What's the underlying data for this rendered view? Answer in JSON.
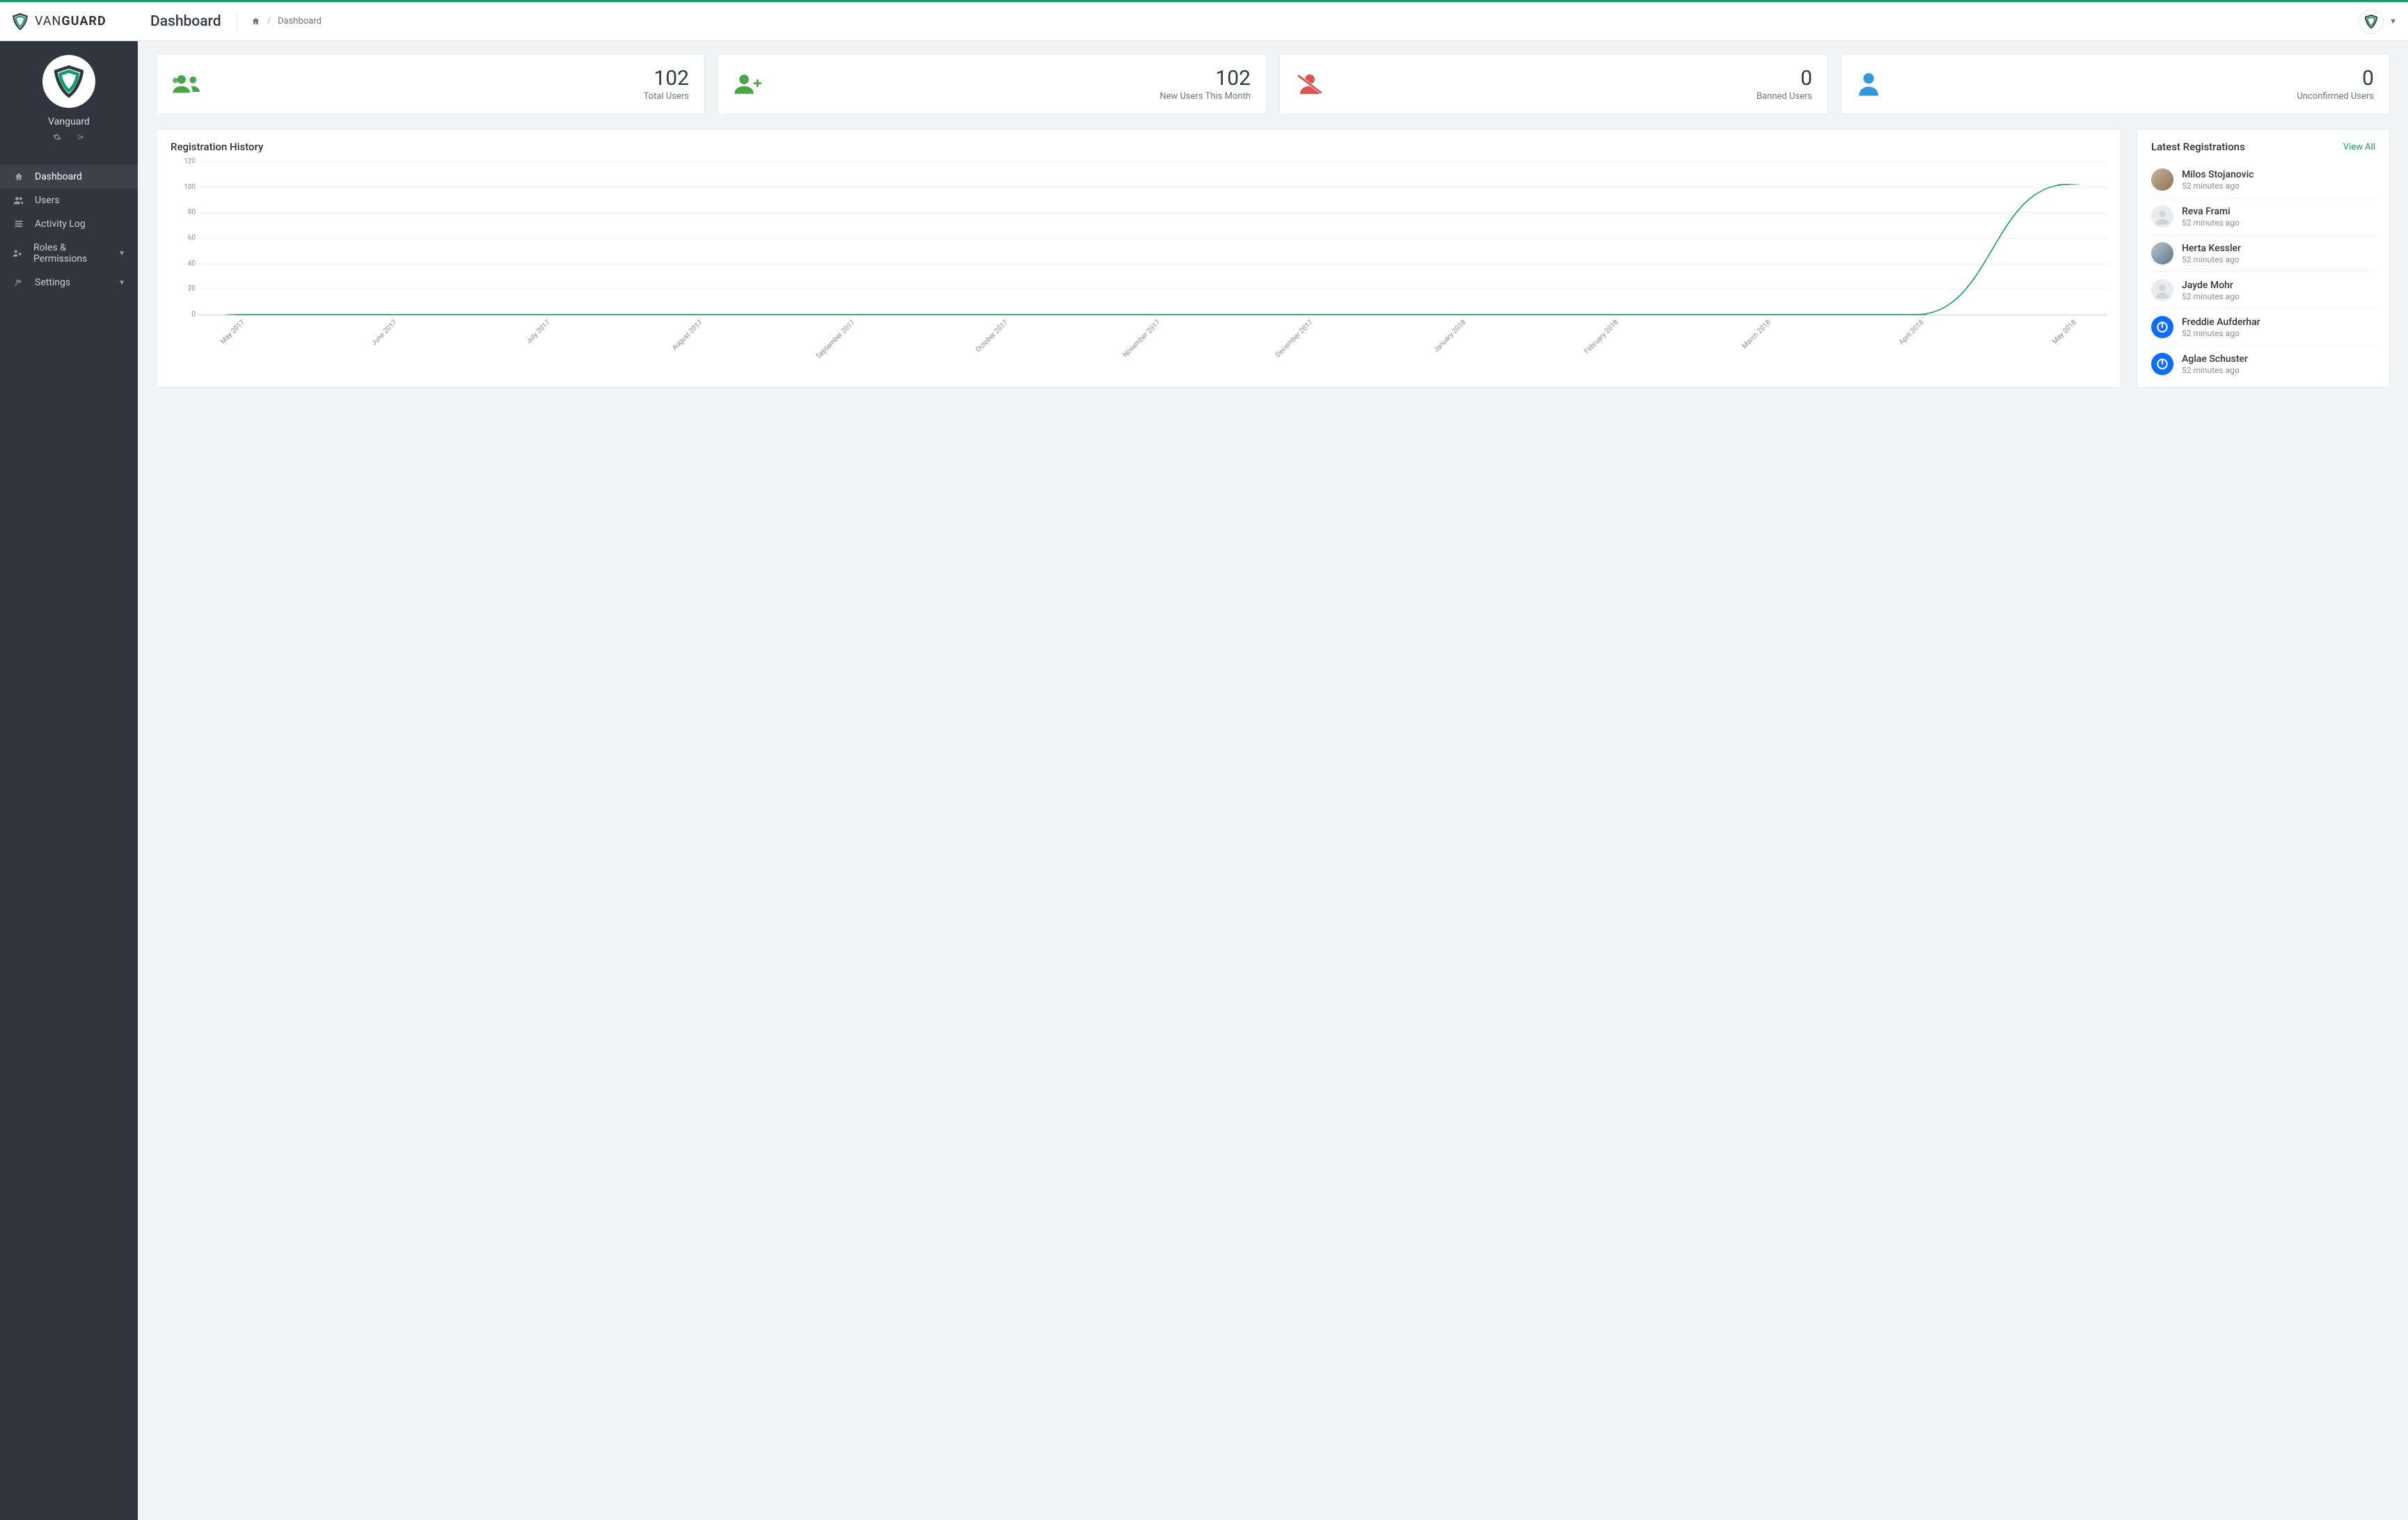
{
  "brand": {
    "name_light": "VAN",
    "name_bold": "GUARD"
  },
  "header": {
    "page_title": "Dashboard",
    "breadcrumb_current": "Dashboard"
  },
  "sidebar": {
    "username": "Vanguard",
    "items": [
      {
        "label": "Dashboard",
        "icon": "home",
        "active": true,
        "expandable": false
      },
      {
        "label": "Users",
        "icon": "users",
        "active": false,
        "expandable": false
      },
      {
        "label": "Activity Log",
        "icon": "list",
        "active": false,
        "expandable": false
      },
      {
        "label": "Roles & Permissions",
        "icon": "users-cog",
        "active": false,
        "expandable": true
      },
      {
        "label": "Settings",
        "icon": "cogs",
        "active": false,
        "expandable": true
      }
    ]
  },
  "stats": [
    {
      "value": "102",
      "label": "Total Users",
      "icon": "users",
      "color": "green"
    },
    {
      "value": "102",
      "label": "New Users This Month",
      "icon": "user-plus",
      "color": "green"
    },
    {
      "value": "0",
      "label": "Banned Users",
      "icon": "user-slash",
      "color": "red"
    },
    {
      "value": "0",
      "label": "Unconfirmed Users",
      "icon": "user",
      "color": "blue"
    }
  ],
  "chart": {
    "title": "Registration History"
  },
  "latest": {
    "title": "Latest Registrations",
    "view_all": "View All",
    "items": [
      {
        "name": "Milos Stojanovic",
        "time": "52 minutes ago",
        "avatar": "photo1"
      },
      {
        "name": "Reva Frami",
        "time": "52 minutes ago",
        "avatar": "placeholder"
      },
      {
        "name": "Herta Kessler",
        "time": "52 minutes ago",
        "avatar": "photo2"
      },
      {
        "name": "Jayde Mohr",
        "time": "52 minutes ago",
        "avatar": "placeholder"
      },
      {
        "name": "Freddie Aufderhar",
        "time": "52 minutes ago",
        "avatar": "power"
      },
      {
        "name": "Aglae Schuster",
        "time": "52 minutes ago",
        "avatar": "power"
      }
    ]
  },
  "chart_data": {
    "type": "line",
    "title": "Registration History",
    "xlabel": "",
    "ylabel": "",
    "ylim": [
      0,
      120
    ],
    "yticks": [
      0,
      20,
      40,
      60,
      80,
      100,
      120
    ],
    "categories": [
      "May 2017",
      "June 2017",
      "July 2017",
      "August 2017",
      "September 2017",
      "October 2017",
      "November 2017",
      "December 2017",
      "January 2018",
      "February 2018",
      "March 2018",
      "April 2018",
      "May 2018"
    ],
    "values": [
      0,
      0,
      0,
      0,
      0,
      0,
      0,
      0,
      0,
      0,
      0,
      0,
      102
    ]
  }
}
